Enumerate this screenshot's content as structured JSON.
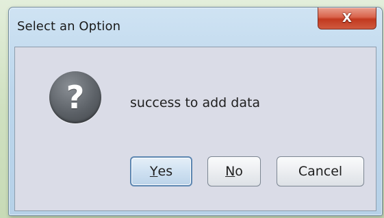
{
  "window": {
    "title": "Select an Option",
    "close_label": "X"
  },
  "dialog": {
    "icon": "question-icon",
    "icon_glyph": "?",
    "message": "success to add data"
  },
  "buttons": {
    "yes": {
      "mnemonic": "Y",
      "rest": "es",
      "is_default": true
    },
    "no": {
      "mnemonic": "N",
      "rest": "o"
    },
    "cancel": {
      "label": "Cancel"
    }
  },
  "colors": {
    "title_bar": "#bcd6ec",
    "close_button": "#c2391f",
    "content_background": "#dadce7",
    "icon_background": "#5c6167",
    "default_button_border": "#5c86b1"
  }
}
